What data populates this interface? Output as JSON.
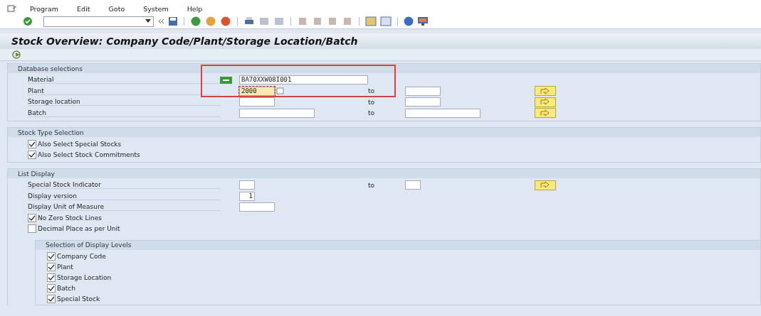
{
  "menu": [
    "Program",
    "Edit",
    "Goto",
    "System",
    "Help"
  ],
  "title": "Stock Overview: Company Code/Plant/Storage Location/Batch",
  "database_selections": {
    "heading": "Database selections",
    "rows": [
      {
        "label": "Material",
        "required": true,
        "value": "BA70XXW08I001",
        "focused": false
      },
      {
        "label": "Plant",
        "value": "2000",
        "focused": true,
        "to": "to"
      },
      {
        "label": "Storage location",
        "value": "",
        "focused": false,
        "to": "to"
      },
      {
        "label": "Batch",
        "value": "",
        "focused": false,
        "to": "to"
      }
    ]
  },
  "stock_type_selection": {
    "heading": "Stock Type Selection",
    "options": [
      {
        "label": "Also Select Special Stocks",
        "checked": true
      },
      {
        "label": "Also Select Stock Commitments",
        "checked": true
      }
    ]
  },
  "list_display": {
    "heading": "List Display",
    "rows": [
      {
        "label": "Special Stock Indicator",
        "value": "",
        "to": "to"
      },
      {
        "label": "Display version",
        "value": "1"
      },
      {
        "label": "Display Unit of Measure",
        "value": ""
      }
    ],
    "options": [
      {
        "label": "No Zero Stock Lines",
        "checked": true
      },
      {
        "label": "Decimal Place as per Unit",
        "checked": false
      }
    ],
    "levels": {
      "heading": "Selection of Display Levels",
      "options": [
        {
          "label": "Company Code",
          "checked": true
        },
        {
          "label": "Plant",
          "checked": true
        },
        {
          "label": "Storage Location",
          "checked": true
        },
        {
          "label": "Batch",
          "checked": true
        },
        {
          "label": "Special Stock",
          "checked": true
        }
      ]
    }
  }
}
